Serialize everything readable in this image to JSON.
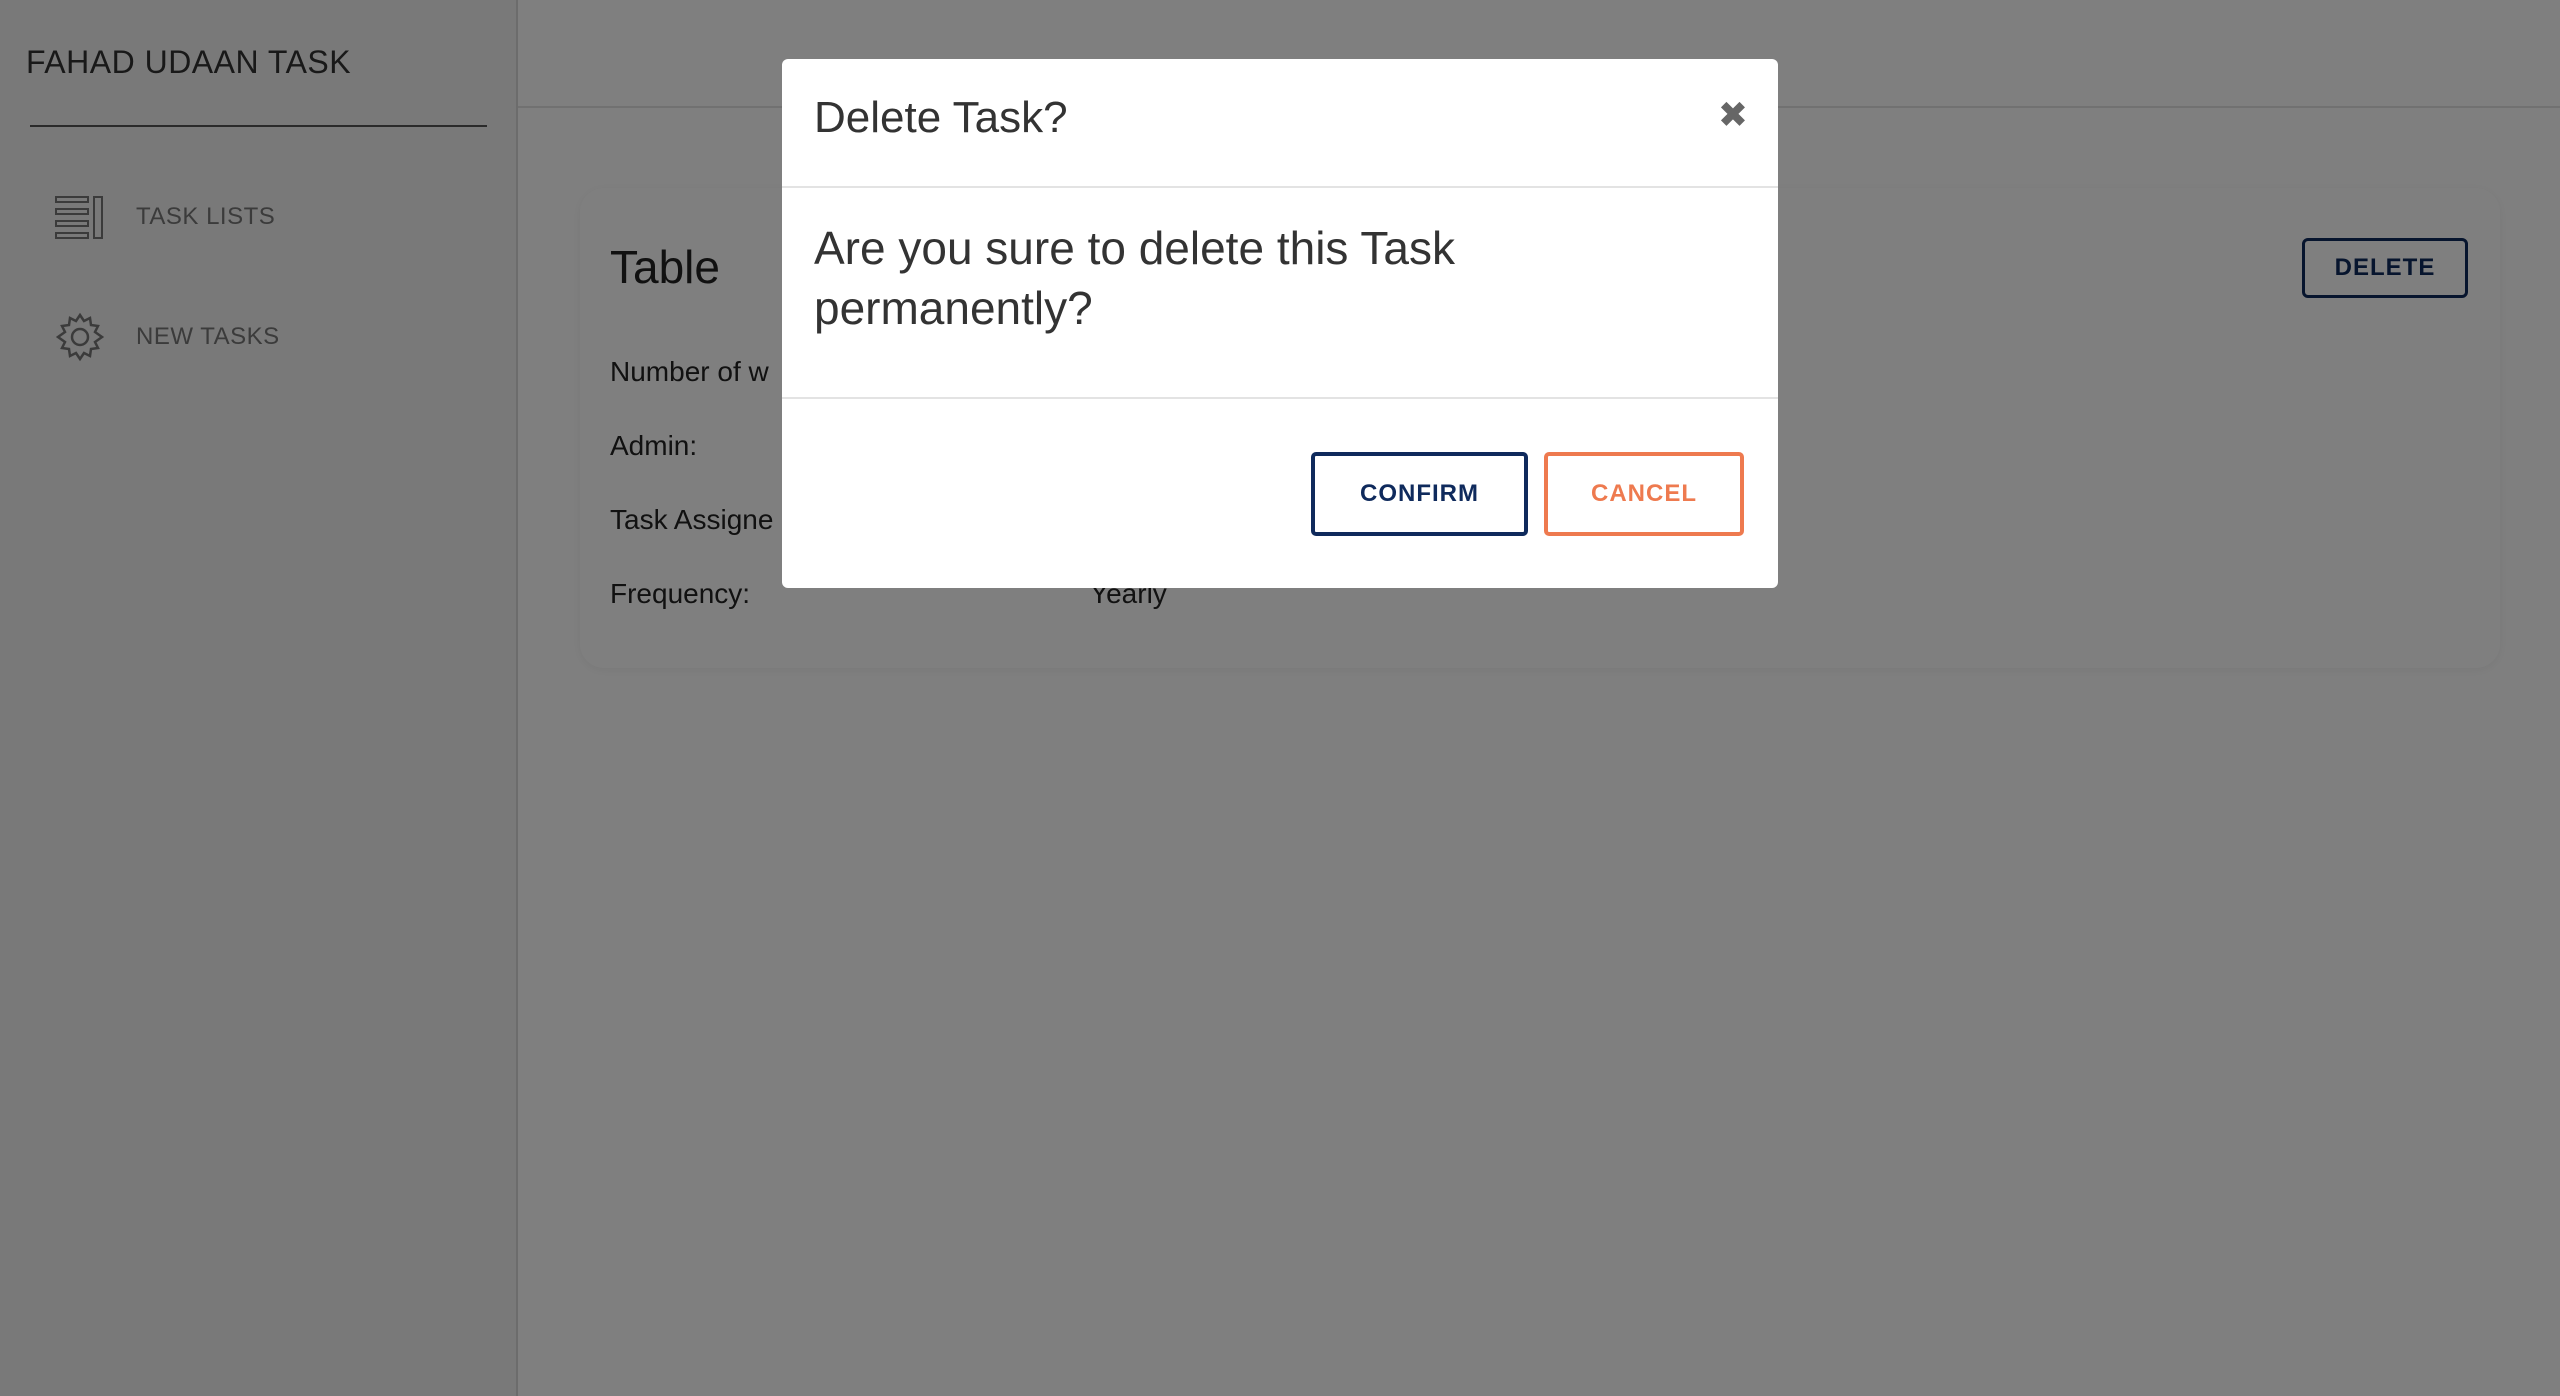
{
  "sidebar": {
    "brand": "FAHAD UDAAN TASK",
    "items": [
      {
        "label": "TASK LISTS",
        "icon": "list-icon"
      },
      {
        "label": "NEW TASKS",
        "icon": "gear-icon"
      }
    ]
  },
  "card": {
    "title": "Table",
    "delete_label": "DELETE",
    "fields": [
      {
        "label": "Number of w",
        "value": ""
      },
      {
        "label": "Admin:",
        "value": ""
      },
      {
        "label": "Task Assigne",
        "value": ""
      },
      {
        "label": "Frequency:",
        "value": "Yearly"
      }
    ]
  },
  "modal": {
    "title": "Delete Task?",
    "close_icon": "close-icon",
    "message": "Are you sure to delete this Task permanently?",
    "confirm_label": "CONFIRM",
    "cancel_label": "CANCEL"
  },
  "colors": {
    "primary": "#0f2a5c",
    "accent": "#ee7a4f",
    "overlay": "rgba(0,0,0,0.5)"
  }
}
